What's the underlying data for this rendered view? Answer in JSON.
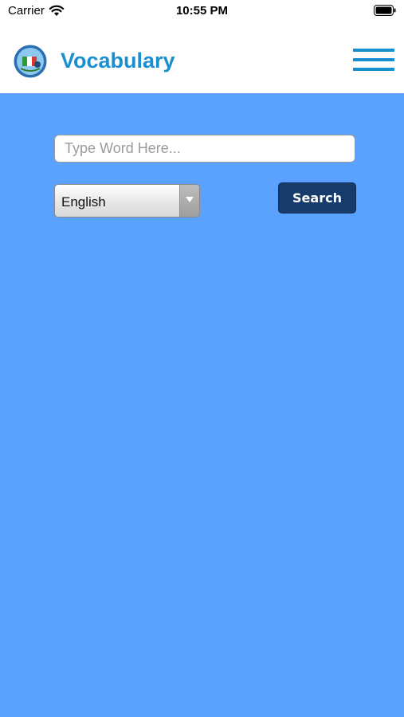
{
  "status_bar": {
    "carrier": "Carrier",
    "time": "10:55 PM",
    "wifi_icon": "wifi-icon",
    "battery_icon": "battery-icon"
  },
  "header": {
    "title": "Vocabulary",
    "logo_icon": "app-logo-globe",
    "menu_icon": "hamburger-menu-icon",
    "title_color": "#1a8fd0"
  },
  "search": {
    "placeholder": "Type Word Here...",
    "value": "",
    "button_label": "Search"
  },
  "language": {
    "selected": "English"
  },
  "colors": {
    "background": "#5aa2fd",
    "button": "#173c6c",
    "accent": "#1a8fd0"
  }
}
